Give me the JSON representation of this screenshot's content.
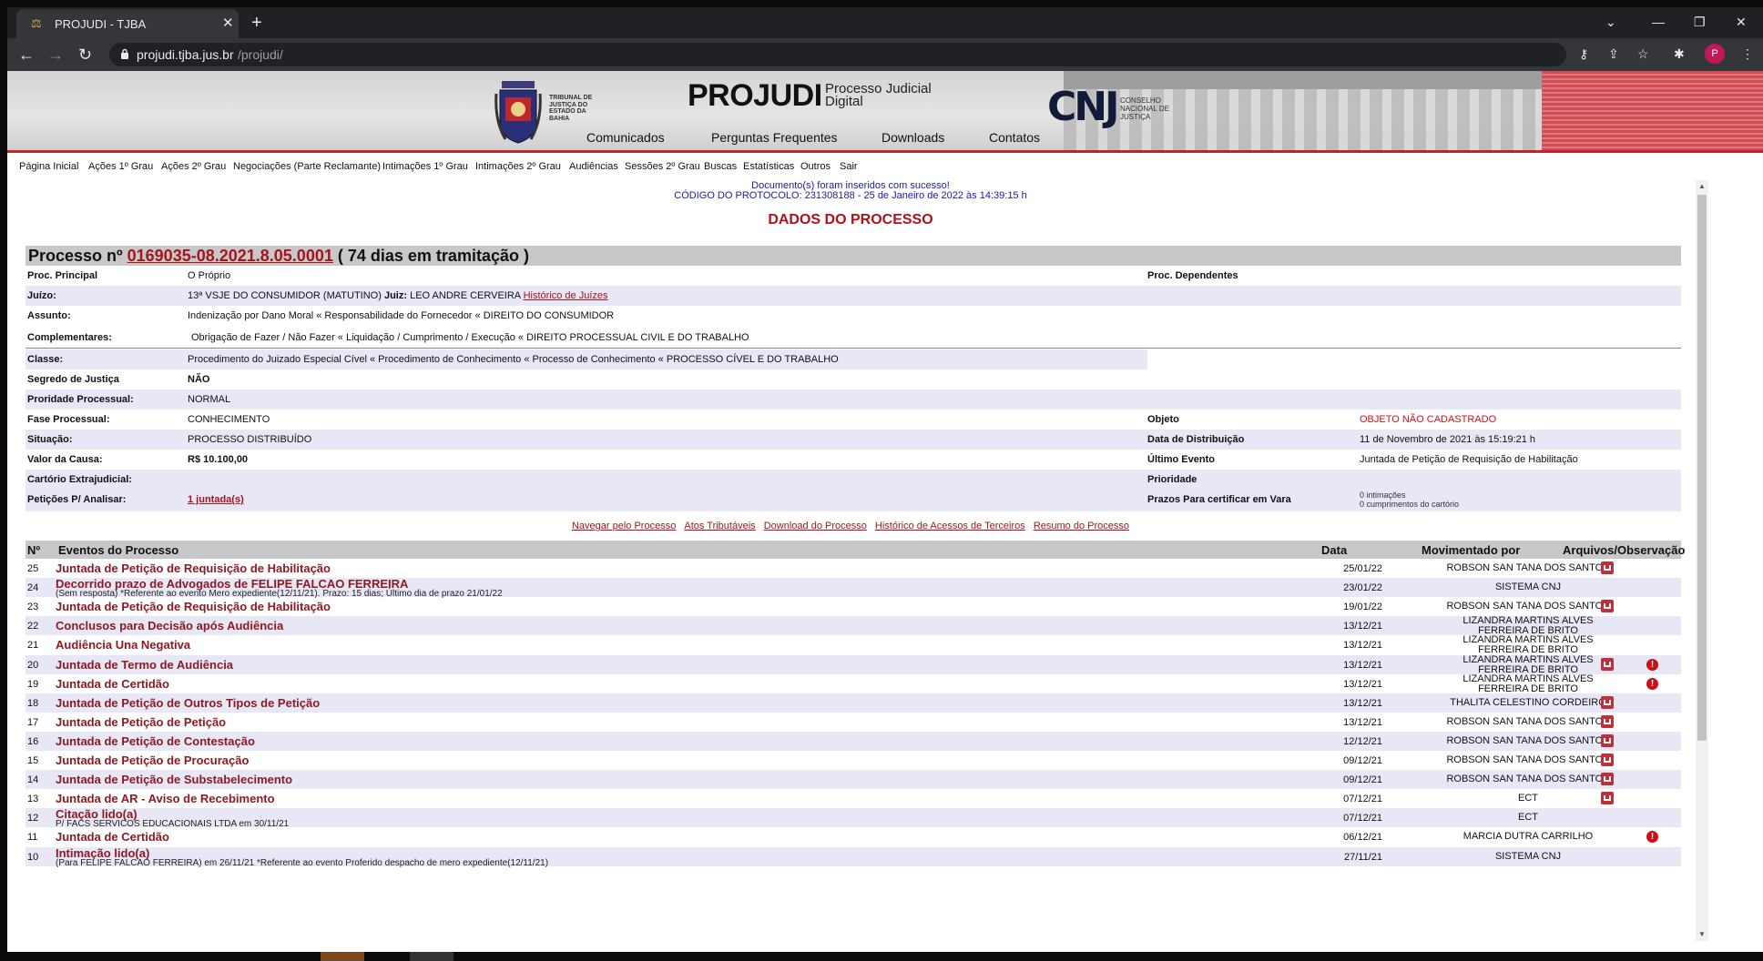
{
  "browser": {
    "tab_title": "PROJUDI - TJBA",
    "url_host": "projudi.tjba.jus.br",
    "url_path": "/projudi/",
    "profile_initial": "P"
  },
  "banner": {
    "tj_text": "TRIBUNAL DE JUSTIÇA DO ESTADO DA BAHIA",
    "logo": "PROJUDI",
    "logo_sub": "Processo Judicial Digital",
    "cnj_logo": "CNJ",
    "cnj_text": "CONSELHO NACIONAL DE JUSTIÇA",
    "nav": [
      "Comunicados",
      "Perguntas Frequentes",
      "Downloads",
      "Contatos"
    ]
  },
  "menu": [
    "Página Inicial",
    "Ações 1º Grau",
    "Ações 2º Grau",
    "Negociações (Parte Reclamante)",
    "Intimações 1º Grau",
    "Intimações 2º Grau",
    "Audiências",
    "Sessões 2º Grau",
    "Buscas",
    "Estatísticas",
    "Outros",
    "Sair"
  ],
  "messages": {
    "success": "Documento(s) foram inseridos com sucesso!",
    "protocol": "CÓDIGO DO PROTOCOLO: 231308188 - 25 de Janeiro de 2022 às 14:39:15 h"
  },
  "section_title": "DADOS DO PROCESSO",
  "process": {
    "prefix": "Processo nº",
    "number": "0169035-08.2021.8.05.0001",
    "suffix": "( 74 dias em tramitação )"
  },
  "fields": {
    "proc_principal_label": "Proc. Principal",
    "proc_principal_value": "O Próprio",
    "proc_dependentes_label": "Proc. Dependentes",
    "juizo_label": "Juízo:",
    "juizo_value": "13ª VSJE DO CONSUMIDOR (MATUTINO)",
    "juiz_label": "Juiz:",
    "juiz_value": "LEO ANDRE CERVEIRA",
    "historico_juizes": "Histórico de Juízes",
    "assunto_label": "Assunto:",
    "assunto_value": "Indenização por Dano Moral « Responsabilidade do Fornecedor « DIREITO DO CONSUMIDOR",
    "complementares_label": "Complementares:",
    "complementares_value": "Obrigação de Fazer / Não Fazer « Liquidação / Cumprimento / Execução « DIREITO PROCESSUAL CIVIL E DO TRABALHO",
    "classe_label": "Classe:",
    "classe_value": "Procedimento do Juizado Especial Cível « Procedimento de Conhecimento « Processo de Conhecimento « PROCESSO CÍVEL E DO TRABALHO",
    "segredo_label": "Segredo de Justiça",
    "segredo_value": "NÃO",
    "prioridade_proc_label": "Proridade Processual:",
    "prioridade_proc_value": "NORMAL",
    "fase_label": "Fase Processual:",
    "fase_value": "CONHECIMENTO",
    "objeto_label": "Objeto",
    "objeto_value": "OBJETO NÃO CADASTRADO",
    "situacao_label": "Situação:",
    "situacao_value": "PROCESSO DISTRIBUÍDO",
    "data_dist_label": "Data de Distribuição",
    "data_dist_value": "11 de Novembro de 2021 às 15:19:21 h",
    "valor_label": "Valor da Causa:",
    "valor_value": "R$ 10.100,00",
    "ultimo_evento_label": "Último Evento",
    "ultimo_evento_value": "Juntada de Petição de Requisição de Habilitação",
    "cartorio_label": "Cartório Extrajudicial:",
    "prioridade_label": "Prioridade",
    "peticoes_label": "Petições P/ Analisar:",
    "peticoes_value": "1 juntada(s)",
    "prazos_label": "Prazos Para certificar em Vara",
    "prazos_value1": "0 intimações",
    "prazos_value2": "0 cumprimentos do cartório"
  },
  "actions": [
    "Navegar pelo Processo",
    "Atos Tributáveis",
    "Download do Processo",
    "Histórico de Acessos de Terceiros",
    "Resumo do Processo"
  ],
  "events_header": {
    "num": "Nº",
    "events": "Eventos do Processo",
    "date": "Data",
    "moved_by": "Movimentado por",
    "files": "Arquivos/Observação"
  },
  "events": [
    {
      "n": "25",
      "title": "Juntada de Petição de Requisição de Habilitação",
      "sub": "",
      "date": "25/01/22",
      "mov": "ROBSON SAN TANA DOS SANTOS",
      "mov2": "",
      "pdf": true,
      "obs": false
    },
    {
      "n": "24",
      "title": "Decorrido prazo de Advogados de FELIPE FALCAO FERREIRA",
      "sub": "(Sem resposta) *Referente ao evento Mero expediente(12/11/21). Prazo: 15 dias; Último dia de prazo 21/01/22",
      "date": "23/01/22",
      "mov": "SISTEMA CNJ",
      "mov2": "",
      "pdf": false,
      "obs": false
    },
    {
      "n": "23",
      "title": "Juntada de Petição de Requisição de Habilitação",
      "sub": "",
      "date": "19/01/22",
      "mov": "ROBSON SAN TANA DOS SANTOS",
      "mov2": "",
      "pdf": true,
      "obs": false
    },
    {
      "n": "22",
      "title": "Conclusos para Decisão após Audiência",
      "sub": "",
      "date": "13/12/21",
      "mov": "LIZANDRA MARTINS ALVES",
      "mov2": "FERREIRA DE BRITO",
      "pdf": false,
      "obs": false
    },
    {
      "n": "21",
      "title": "Audiência Una Negativa",
      "sub": "",
      "date": "13/12/21",
      "mov": "LIZANDRA MARTINS ALVES",
      "mov2": "FERREIRA DE BRITO",
      "pdf": false,
      "obs": false
    },
    {
      "n": "20",
      "title": "Juntada de Termo de Audiência",
      "sub": "",
      "date": "13/12/21",
      "mov": "LIZANDRA MARTINS ALVES",
      "mov2": "FERREIRA DE BRITO",
      "pdf": true,
      "obs": true
    },
    {
      "n": "19",
      "title": "Juntada de Certidão",
      "sub": "",
      "date": "13/12/21",
      "mov": "LIZANDRA MARTINS ALVES",
      "mov2": "FERREIRA DE BRITO",
      "pdf": false,
      "obs": true
    },
    {
      "n": "18",
      "title": "Juntada de Petição de Outros Tipos de Petição",
      "sub": "",
      "date": "13/12/21",
      "mov": "THALITA CELESTINO CORDEIRO",
      "mov2": "",
      "pdf": true,
      "obs": false
    },
    {
      "n": "17",
      "title": "Juntada de Petição de Petição",
      "sub": "",
      "date": "13/12/21",
      "mov": "ROBSON SAN TANA DOS SANTOS",
      "mov2": "",
      "pdf": true,
      "obs": false
    },
    {
      "n": "16",
      "title": "Juntada de Petição de Contestação",
      "sub": "",
      "date": "12/12/21",
      "mov": "ROBSON SAN TANA DOS SANTOS",
      "mov2": "",
      "pdf": true,
      "obs": false
    },
    {
      "n": "15",
      "title": "Juntada de Petição de Procuração",
      "sub": "",
      "date": "09/12/21",
      "mov": "ROBSON SAN TANA DOS SANTOS",
      "mov2": "",
      "pdf": true,
      "obs": false
    },
    {
      "n": "14",
      "title": "Juntada de Petição de Substabelecimento",
      "sub": "",
      "date": "09/12/21",
      "mov": "ROBSON SAN TANA DOS SANTOS",
      "mov2": "",
      "pdf": true,
      "obs": false
    },
    {
      "n": "13",
      "title": "Juntada de AR - Aviso de Recebimento",
      "sub": "",
      "date": "07/12/21",
      "mov": "ECT",
      "mov2": "",
      "pdf": true,
      "obs": false
    },
    {
      "n": "12",
      "title": "Citação lido(a)",
      "sub": "P/ FACS SERVICOS EDUCACIONAIS LTDA em 30/11/21",
      "date": "07/12/21",
      "mov": "ECT",
      "mov2": "",
      "pdf": false,
      "obs": false
    },
    {
      "n": "11",
      "title": "Juntada de Certidão",
      "sub": "",
      "date": "06/12/21",
      "mov": "MARCIA DUTRA CARRILHO",
      "mov2": "",
      "pdf": false,
      "obs": true
    },
    {
      "n": "10",
      "title": "Intimação lido(a)",
      "sub": "(Para FELIPE FALCAO FERREIRA) em 26/11/21 *Referente ao evento Proferido despacho de mero expediente(12/11/21)",
      "date": "27/11/21",
      "mov": "SISTEMA CNJ",
      "mov2": "",
      "pdf": false,
      "obs": false
    }
  ]
}
